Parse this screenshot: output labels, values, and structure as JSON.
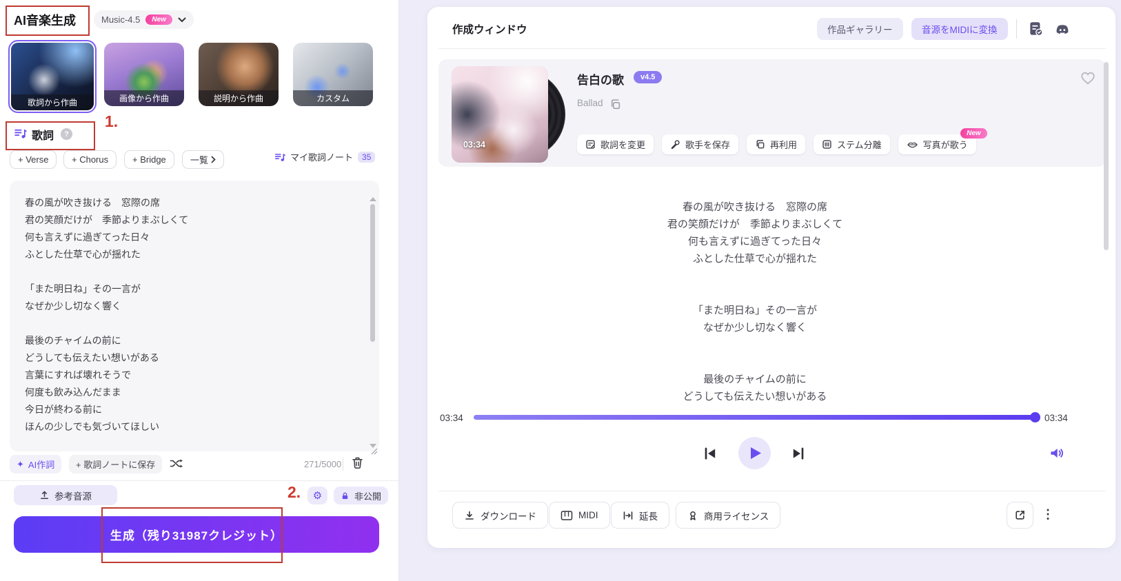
{
  "icons": {
    "sparkle": "✦",
    "gear": "⚙",
    "kebab": "⋮",
    "question": "?"
  },
  "annotations": {
    "step1": "1.",
    "step2": "2."
  },
  "left": {
    "title": "AI音楽生成",
    "model": {
      "name": "Music-4.5",
      "badge": "New"
    },
    "modes": [
      {
        "label": "歌詞から作曲"
      },
      {
        "label": "画像から作曲"
      },
      {
        "label": "説明から作曲"
      },
      {
        "label": "カスタム"
      }
    ],
    "lyrics": {
      "title": "歌詞",
      "verse": "+ Verse",
      "chorus": "+ Chorus",
      "bridge": "+ Bridge",
      "list": "一覧",
      "my_notes": "マイ歌詞ノート",
      "my_notes_count": "35",
      "text": "春の風が吹き抜ける　窓際の席\n君の笑顔だけが　季節よりまぶしくて\n何も言えずに過ぎてった日々\nふとした仕草で心が揺れた\n\n「また明日ね」その一言が\nなぜか少し切なく響く\n\n最後のチャイムの前に\nどうしても伝えたい想いがある\n言葉にすれば壊れそうで\n何度も飲み込んだまま\n今日が終わる前に\nほんの少しでも気づいてほしい",
      "ai_write": "AI作詞",
      "save_note": "+ 歌詞ノートに保存",
      "char_count": "271/5000"
    },
    "reference_audio": "参考音源",
    "privacy": "非公開",
    "generate": "生成（残り31987クレジット）"
  },
  "right": {
    "title": "作成ウィンドウ",
    "gallery": "作品ギャラリー",
    "midi_convert": "音源をMIDIに変換",
    "song": {
      "title": "告白の歌",
      "version": "v4.5",
      "genre": "Ballad",
      "duration": "03:34",
      "actions": [
        {
          "label": "歌詞を変更"
        },
        {
          "label": "歌手を保存"
        },
        {
          "label": "再利用"
        },
        {
          "label": "ステム分離"
        },
        {
          "label": "写真が歌う",
          "badge": "New"
        }
      ]
    },
    "stanza1": [
      "春の風が吹き抜ける　窓際の席",
      "君の笑顔だけが　季節よりまぶしくて",
      "何も言えずに過ぎてった日々",
      "ふとした仕草で心が揺れた"
    ],
    "stanza2": [
      "「また明日ね」その一言が",
      "なぜか少し切なく響く"
    ],
    "stanza3": [
      "最後のチャイムの前に",
      "どうしても伝えたい想いがある"
    ],
    "player": {
      "elapsed": "03:34",
      "total": "03:34"
    },
    "footer": [
      {
        "label": "ダウンロード"
      },
      {
        "label": "MIDI"
      },
      {
        "label": "延長"
      },
      {
        "label": "商用ライセンス"
      }
    ]
  }
}
